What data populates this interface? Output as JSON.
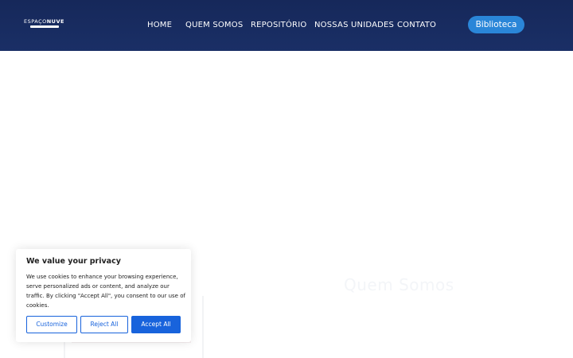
{
  "header": {
    "logo": {
      "text_light": "ESPAÇO",
      "text_bold": "NUVE"
    },
    "nav": [
      {
        "label": "HOME"
      },
      {
        "label": "QUEM SOMOS"
      },
      {
        "label": "REPOSITÓRIO"
      },
      {
        "label": "NOSSAS UNIDADES"
      },
      {
        "label": "CONTATO"
      }
    ],
    "cta_label": "Biblioteca"
  },
  "main": {
    "section_heading": "Quem Somos"
  },
  "cookie_banner": {
    "title": "We value your privacy",
    "text": "We use cookies to enhance your browsing experience, serve personalized ads or content, and analyze our traffic. By clicking \"Accept All\", you consent to our use of cookies.",
    "customize_label": "Customize",
    "reject_label": "Reject All",
    "accept_label": "Accept All"
  },
  "colors": {
    "header_bg": "#1a2f66",
    "cta_bg": "#2a86d8",
    "cookie_accent": "#1863dc"
  }
}
